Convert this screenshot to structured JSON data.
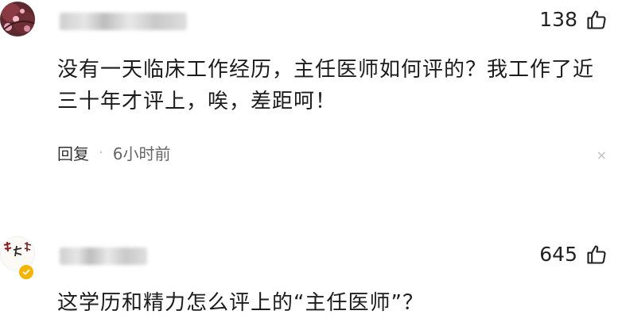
{
  "comments": [
    {
      "likes": "138",
      "text": "没有一天临床工作经历，主任医师如何评的？我工作了近三十年才评上，唉，差距呵！",
      "reply_label": "回复",
      "separator": "·",
      "time": "6小时前",
      "close_glyph": "×"
    },
    {
      "likes": "645",
      "text": "这学历和精力怎么评上的“主任医师”？"
    }
  ],
  "icons": {
    "like": "thumbs-up-icon",
    "close": "close-icon",
    "verified": "verified-badge-icon"
  },
  "colors": {
    "text": "#1c1c1c",
    "meta": "#666666",
    "verified_badge": "#f5b400"
  }
}
